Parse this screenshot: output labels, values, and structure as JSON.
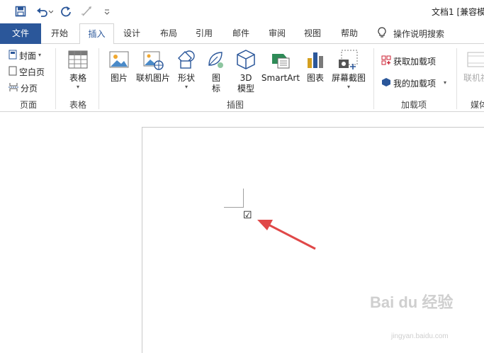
{
  "window": {
    "title": "文档1 [兼容模"
  },
  "qat": {
    "icons": [
      "save-icon",
      "undo-icon",
      "redo-icon",
      "format-painter-icon",
      "customize-icon"
    ]
  },
  "tabs": [
    {
      "label": "文件"
    },
    {
      "label": "开始"
    },
    {
      "label": "插入"
    },
    {
      "label": "设计"
    },
    {
      "label": "布局"
    },
    {
      "label": "引用"
    },
    {
      "label": "邮件"
    },
    {
      "label": "审阅"
    },
    {
      "label": "视图"
    },
    {
      "label": "帮助"
    }
  ],
  "tell_me": {
    "label": "操作说明搜索"
  },
  "ribbon": {
    "pages": {
      "cover": "封面",
      "blank": "空白页",
      "break": "分页",
      "label": "页面"
    },
    "tables": {
      "table": "表格",
      "label": "表格"
    },
    "illustrations": {
      "picture": "图片",
      "online_picture": "联机图片",
      "shapes": "形状",
      "icons_l1": "图",
      "icons_l2": "标",
      "model_l1": "3D",
      "model_l2": "模型",
      "smartart": "SmartArt",
      "chart": "图表",
      "screenshot": "屏幕截图",
      "label": "插图"
    },
    "addins": {
      "get": "获取加载项",
      "mine": "我的加载项",
      "label": "加载项"
    },
    "media": {
      "online_video": "联机视",
      "label": "媒体"
    }
  },
  "document": {
    "checkbox_glyph": "☑"
  },
  "watermark": {
    "main": "Bai du 经验",
    "sub": "jingyan.baidu.com"
  },
  "colors": {
    "accent": "#2b579a",
    "arrow": "#e04848"
  }
}
